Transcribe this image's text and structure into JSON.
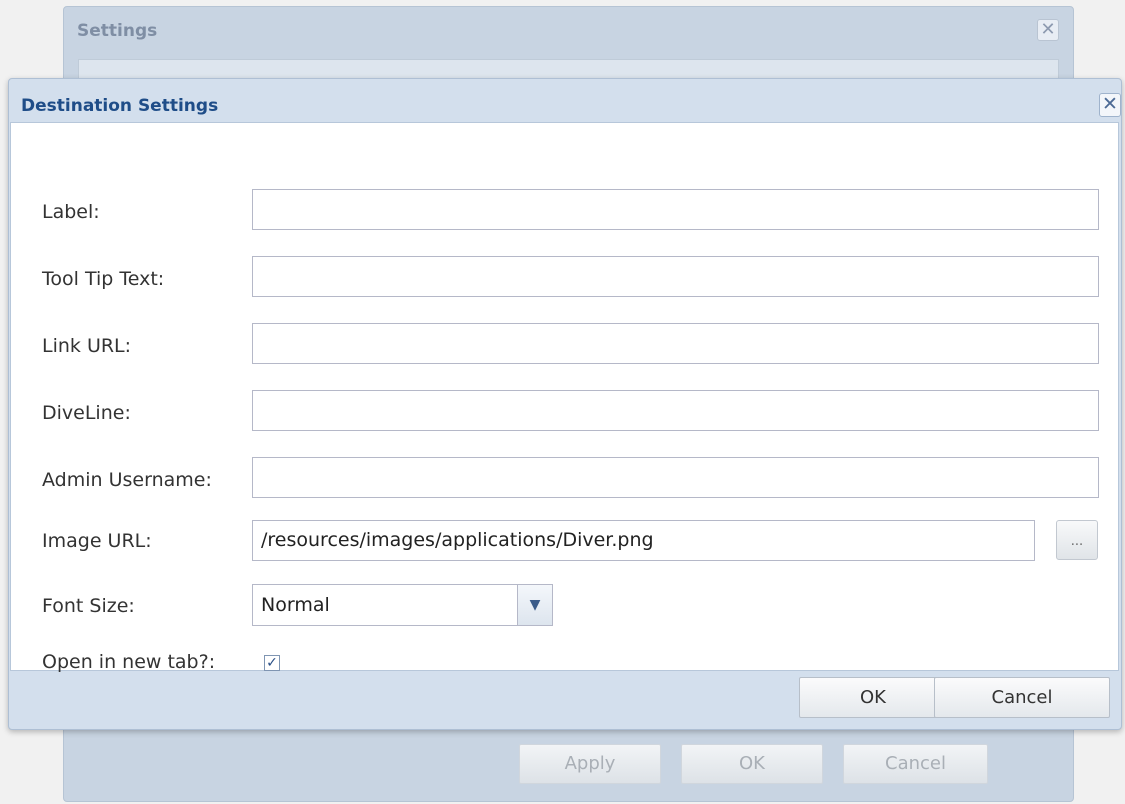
{
  "background_dialog": {
    "title": "Settings",
    "close_glyph": "✕",
    "buttons": {
      "apply": "Apply",
      "ok": "OK",
      "cancel": "Cancel"
    }
  },
  "dialog": {
    "title": "Destination Settings",
    "close_glyph": "✕",
    "fields": {
      "label": {
        "label": "Label:",
        "value": ""
      },
      "tooltip": {
        "label": "Tool Tip Text:",
        "value": ""
      },
      "link_url": {
        "label": "Link URL:",
        "value": ""
      },
      "diveline": {
        "label": "DiveLine:",
        "value": ""
      },
      "admin_username": {
        "label": "Admin Username:",
        "value": ""
      },
      "image_url": {
        "label": "Image URL:",
        "value": "/resources/images/applications/Diver.png",
        "browse_label": "..."
      },
      "font_size": {
        "label": "Font Size:",
        "value": "Normal"
      },
      "open_new_tab": {
        "label": "Open in new tab?:",
        "checked": true
      }
    },
    "buttons": {
      "ok": "OK",
      "cancel": "Cancel"
    }
  }
}
